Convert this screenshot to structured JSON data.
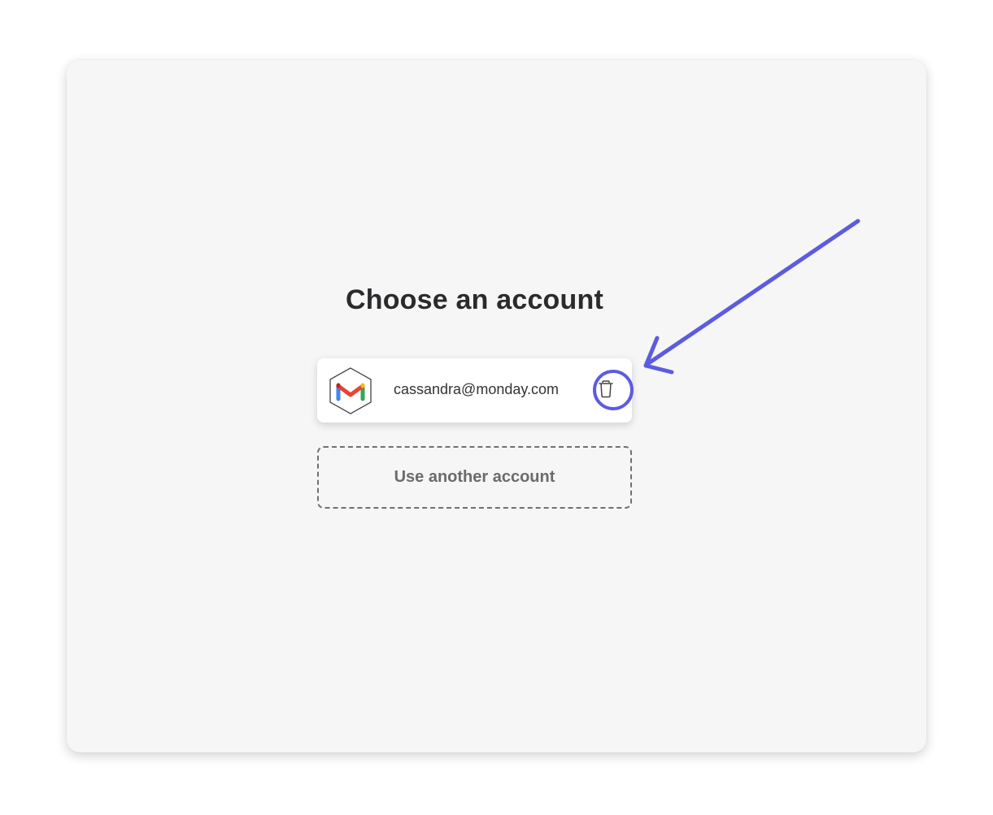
{
  "page": {
    "title": "Choose an account"
  },
  "account": {
    "email": "cassandra@monday.com",
    "provider_icon": "gmail-icon",
    "delete_icon": "trash-icon"
  },
  "actions": {
    "use_another_label": "Use another account"
  },
  "annotation": {
    "color": "#5b5ce0",
    "arrow_icon": "arrow-pointer",
    "ring_icon": "highlight-circle"
  },
  "colors": {
    "panel_bg": "#f6f6f6",
    "title_text": "#2b2b2e",
    "gmail_red": "#ea4335",
    "gmail_blue": "#4285f4",
    "gmail_green": "#34a853",
    "gmail_yellow": "#fbbc04"
  }
}
